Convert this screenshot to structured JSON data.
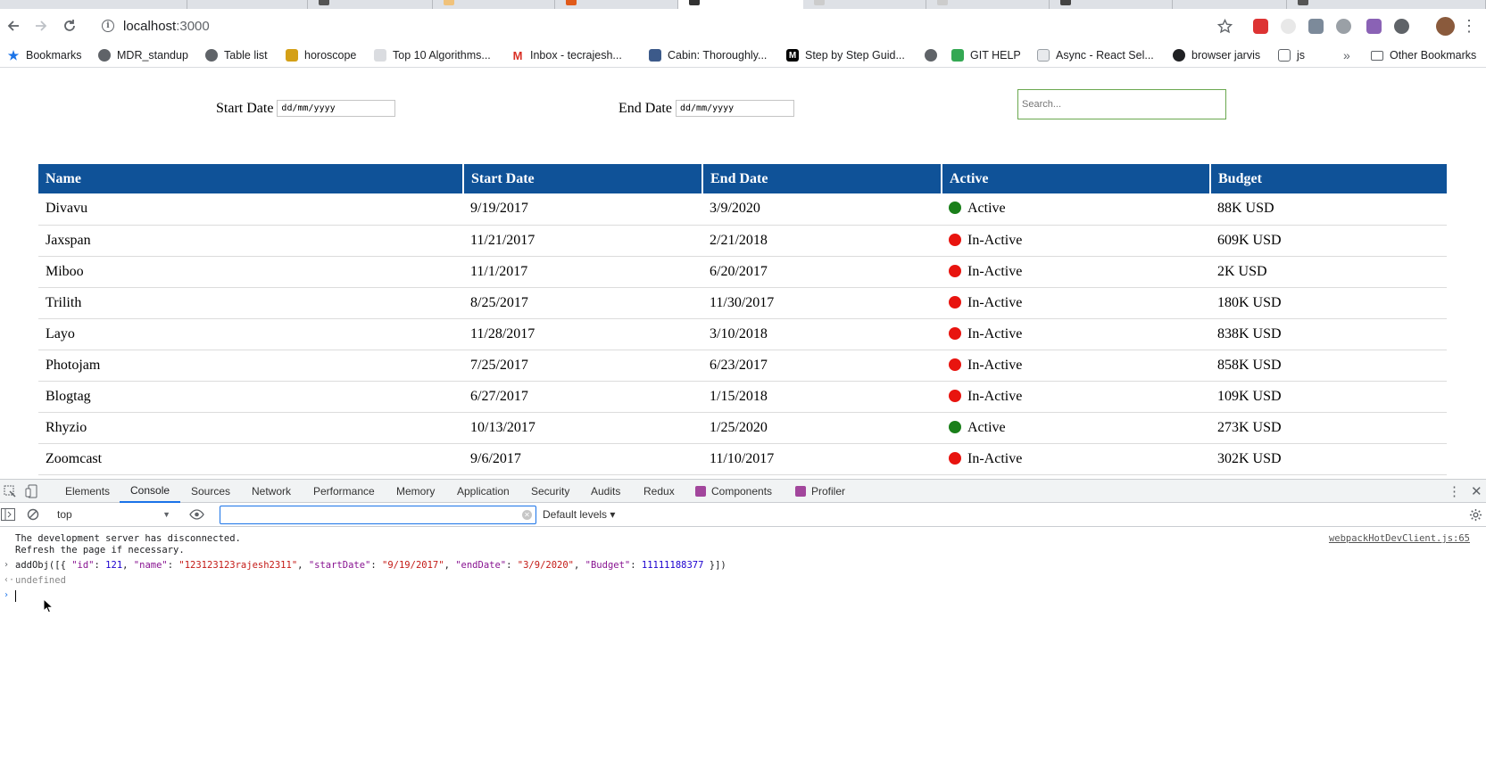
{
  "browser": {
    "url_host": "localhost",
    "url_port": ":3000",
    "bookmarks": [
      {
        "label": "Bookmarks",
        "icon": "star-icon",
        "color": "#1a73e8"
      },
      {
        "label": "MDR_standup",
        "icon": "globe-icon",
        "color": "#5f6368"
      },
      {
        "label": "Table list",
        "icon": "globe-icon",
        "color": "#5f6368"
      },
      {
        "label": "horoscope",
        "icon": "horoscope-icon",
        "color": "#d4a017"
      },
      {
        "label": "Top 10 Algorithms...",
        "icon": "chart-icon",
        "color": "#9aa0a6"
      },
      {
        "label": "Inbox - tecrajesh...",
        "icon": "gmail-icon",
        "color": "#d93025"
      },
      {
        "label": "Cabin: Thoroughly...",
        "icon": "docker-icon",
        "color": "#3c5a8a"
      },
      {
        "label": "Step by Step Guid...",
        "icon": "medium-icon",
        "color": "#000000"
      },
      {
        "label": "",
        "icon": "globe-icon",
        "color": "#5f6368"
      },
      {
        "label": "GIT HELP",
        "icon": "git-icon",
        "color": "#34a853"
      },
      {
        "label": "Async - React Sel...",
        "icon": "page-icon",
        "color": "#5f6368"
      },
      {
        "label": "browser jarvis",
        "icon": "github-icon",
        "color": "#202124"
      },
      {
        "label": "js",
        "icon": "book-icon",
        "color": "#5f6368"
      }
    ],
    "more_bookmarks": "»",
    "other_bookmarks": "Other Bookmarks"
  },
  "filters": {
    "start_label": "Start Date",
    "start_value": "dd/mm/yyyy",
    "end_label": "End Date",
    "end_value": "dd/mm/yyyy",
    "search_placeholder": "Search..."
  },
  "table": {
    "columns": [
      "Name",
      "Start Date",
      "End Date",
      "Active",
      "Budget"
    ],
    "rows": [
      {
        "name": "Divavu",
        "start": "9/19/2017",
        "end": "3/9/2020",
        "status": "Active",
        "active": true,
        "budget": "88K USD"
      },
      {
        "name": "Jaxspan",
        "start": "11/21/2017",
        "end": "2/21/2018",
        "status": "In-Active",
        "active": false,
        "budget": "609K USD"
      },
      {
        "name": "Miboo",
        "start": "11/1/2017",
        "end": "6/20/2017",
        "status": "In-Active",
        "active": false,
        "budget": "2K USD"
      },
      {
        "name": "Trilith",
        "start": "8/25/2017",
        "end": "11/30/2017",
        "status": "In-Active",
        "active": false,
        "budget": "180K USD"
      },
      {
        "name": "Layo",
        "start": "11/28/2017",
        "end": "3/10/2018",
        "status": "In-Active",
        "active": false,
        "budget": "838K USD"
      },
      {
        "name": "Photojam",
        "start": "7/25/2017",
        "end": "6/23/2017",
        "status": "In-Active",
        "active": false,
        "budget": "858K USD"
      },
      {
        "name": "Blogtag",
        "start": "6/27/2017",
        "end": "1/15/2018",
        "status": "In-Active",
        "active": false,
        "budget": "109K USD"
      },
      {
        "name": "Rhyzio",
        "start": "10/13/2017",
        "end": "1/25/2020",
        "status": "Active",
        "active": true,
        "budget": "273K USD"
      },
      {
        "name": "Zoomcast",
        "start": "9/6/2017",
        "end": "11/10/2017",
        "status": "In-Active",
        "active": false,
        "budget": "302K USD"
      }
    ],
    "active_color": "#1a7f1a",
    "inactive_color": "#e8140f",
    "header_color": "#0f5298"
  },
  "devtools": {
    "tabs": [
      "Elements",
      "Console",
      "Sources",
      "Network",
      "Performance",
      "Memory",
      "Application",
      "Security",
      "Audits",
      "Redux",
      "Components",
      "Profiler"
    ],
    "active_tab": "Console",
    "context": "top",
    "levels": "Default levels ▾",
    "messages": {
      "disconnect_line1": "The development server has disconnected.",
      "disconnect_line2": "Refresh the page if necessary.",
      "source": "webpackHotDevClient.js:65",
      "result": "undefined"
    }
  }
}
